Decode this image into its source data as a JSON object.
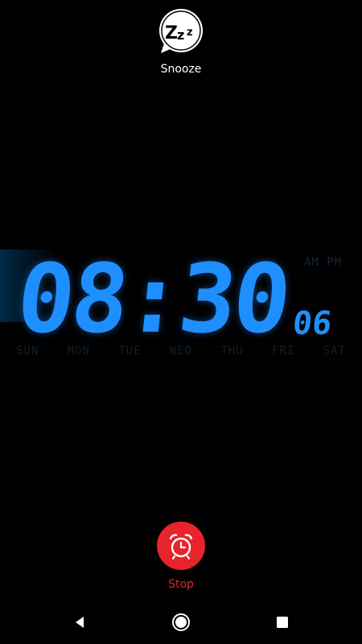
{
  "snooze": {
    "label": "Snooze",
    "icon_text": "Zzz"
  },
  "clock": {
    "time": "08:30",
    "seconds": "06",
    "ampm": "AM PM",
    "days": [
      "SUN",
      "MON",
      "TUE",
      "WED",
      "THU",
      "FRI",
      "SAT"
    ]
  },
  "stop": {
    "label": "Stop"
  },
  "navbar": {
    "back": "back-icon",
    "home": "home-icon",
    "recents": "recents-icon"
  },
  "colors": {
    "digits": "#1f8fff",
    "stop": "#e8232b",
    "background": "#000000"
  }
}
